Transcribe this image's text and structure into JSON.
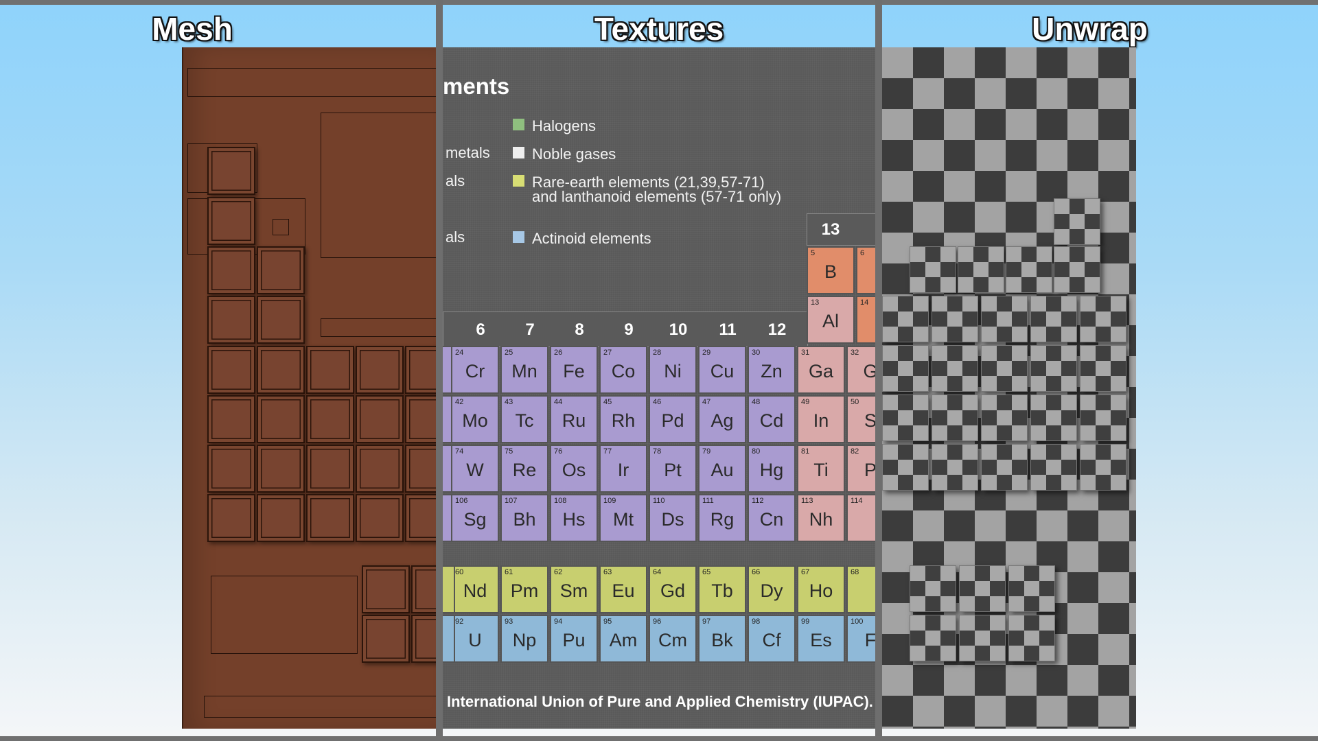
{
  "panels": {
    "mesh": {
      "title": "Mesh"
    },
    "textures": {
      "title": "Textures"
    },
    "unwrap": {
      "title": "Unwrap"
    }
  },
  "textures": {
    "heading": "ments",
    "legend_fragments": [
      "metals",
      "als",
      "als"
    ],
    "legend": [
      {
        "label": "Halogens",
        "color": "#8fbf7f"
      },
      {
        "label": "Noble gases",
        "color": "#eeeeee"
      },
      {
        "label": "Rare-earth elements (21,39,57-71)",
        "label2": "and lanthanoid elements (57-71 only)",
        "color": "#d8de74"
      },
      {
        "label": "Actinoid elements",
        "color": "#a7c8e6"
      }
    ],
    "group13": "13",
    "group_numbers": [
      "6",
      "7",
      "8",
      "9",
      "10",
      "11",
      "12"
    ],
    "col13_elements": [
      {
        "z": "5",
        "sym": "B"
      },
      {
        "z": "13",
        "sym": "Al"
      }
    ],
    "col14_partial_z": [
      "6",
      "14"
    ],
    "rows": [
      [
        {
          "z": "24",
          "sym": "Cr"
        },
        {
          "z": "25",
          "sym": "Mn"
        },
        {
          "z": "26",
          "sym": "Fe"
        },
        {
          "z": "27",
          "sym": "Co"
        },
        {
          "z": "28",
          "sym": "Ni"
        },
        {
          "z": "29",
          "sym": "Cu"
        },
        {
          "z": "30",
          "sym": "Zn"
        },
        {
          "z": "31",
          "sym": "Ga"
        },
        {
          "z": "32",
          "sym": "G"
        }
      ],
      [
        {
          "z": "42",
          "sym": "Mo"
        },
        {
          "z": "43",
          "sym": "Tc"
        },
        {
          "z": "44",
          "sym": "Ru"
        },
        {
          "z": "45",
          "sym": "Rh"
        },
        {
          "z": "46",
          "sym": "Pd"
        },
        {
          "z": "47",
          "sym": "Ag"
        },
        {
          "z": "48",
          "sym": "Cd"
        },
        {
          "z": "49",
          "sym": "In"
        },
        {
          "z": "50",
          "sym": "S"
        }
      ],
      [
        {
          "z": "74",
          "sym": "W"
        },
        {
          "z": "75",
          "sym": "Re"
        },
        {
          "z": "76",
          "sym": "Os"
        },
        {
          "z": "77",
          "sym": "Ir"
        },
        {
          "z": "78",
          "sym": "Pt"
        },
        {
          "z": "79",
          "sym": "Au"
        },
        {
          "z": "80",
          "sym": "Hg"
        },
        {
          "z": "81",
          "sym": "Ti"
        },
        {
          "z": "82",
          "sym": "P"
        }
      ],
      [
        {
          "z": "106",
          "sym": "Sg"
        },
        {
          "z": "107",
          "sym": "Bh"
        },
        {
          "z": "108",
          "sym": "Hs"
        },
        {
          "z": "109",
          "sym": "Mt"
        },
        {
          "z": "110",
          "sym": "Ds"
        },
        {
          "z": "111",
          "sym": "Rg"
        },
        {
          "z": "112",
          "sym": "Cn"
        },
        {
          "z": "113",
          "sym": "Nh"
        },
        {
          "z": "114",
          "sym": ""
        }
      ]
    ],
    "lanthanoids": [
      {
        "z": "60",
        "sym": "Nd"
      },
      {
        "z": "61",
        "sym": "Pm"
      },
      {
        "z": "62",
        "sym": "Sm"
      },
      {
        "z": "63",
        "sym": "Eu"
      },
      {
        "z": "64",
        "sym": "Gd"
      },
      {
        "z": "65",
        "sym": "Tb"
      },
      {
        "z": "66",
        "sym": "Dy"
      },
      {
        "z": "67",
        "sym": "Ho"
      },
      {
        "z": "68",
        "sym": ""
      }
    ],
    "actinoids": [
      {
        "z": "92",
        "sym": "U"
      },
      {
        "z": "93",
        "sym": "Np"
      },
      {
        "z": "94",
        "sym": "Pu"
      },
      {
        "z": "95",
        "sym": "Am"
      },
      {
        "z": "96",
        "sym": "Cm"
      },
      {
        "z": "97",
        "sym": "Bk"
      },
      {
        "z": "98",
        "sym": "Cf"
      },
      {
        "z": "99",
        "sym": "Es"
      },
      {
        "z": "100",
        "sym": "F"
      }
    ],
    "footer": "International Union of Pure and Applied Chemistry (IUPAC)."
  }
}
